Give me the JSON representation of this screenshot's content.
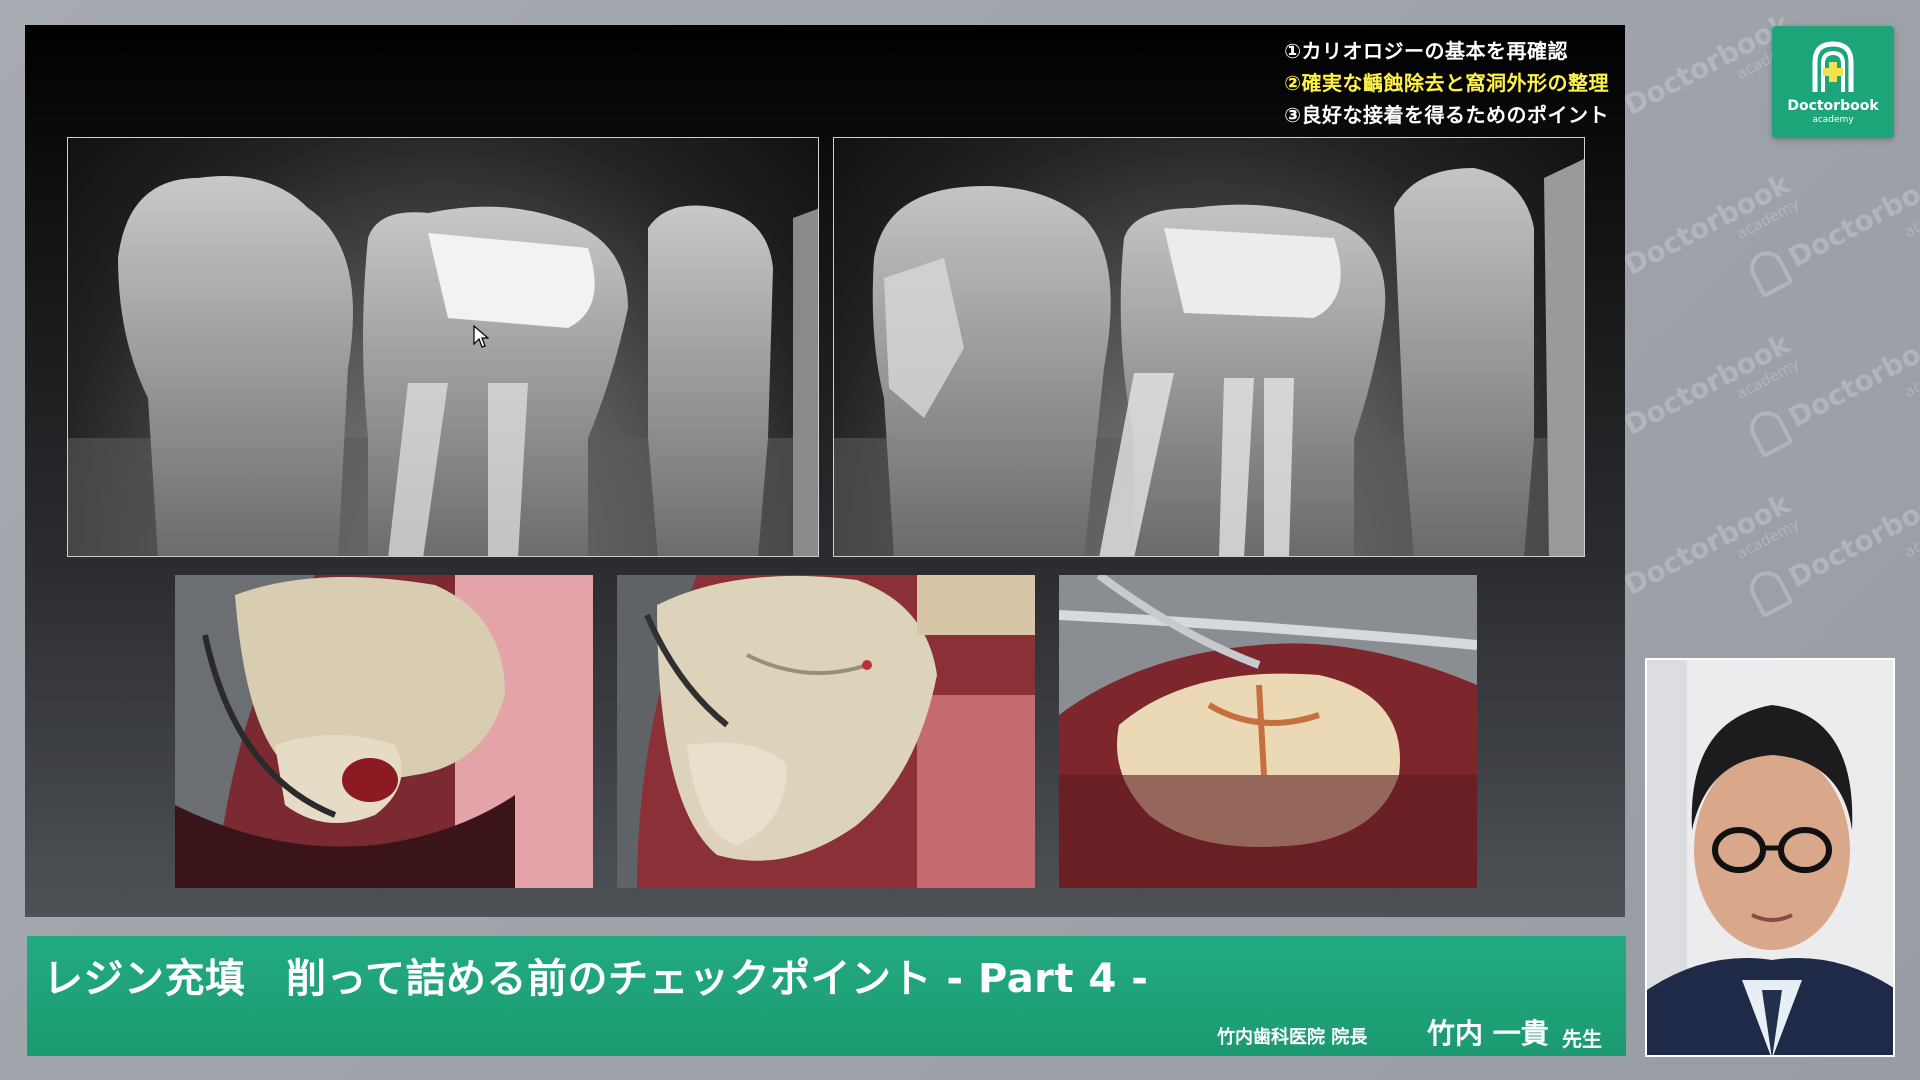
{
  "slide": {
    "points": [
      {
        "text": "①カリオロジーの基本を再確認",
        "highlight": false
      },
      {
        "text": "②確実な齲蝕除去と窩洞外形の整理",
        "highlight": true
      },
      {
        "text": "③良好な接着を得るためのポイント",
        "highlight": false
      }
    ]
  },
  "banner": {
    "title": "レジン充填　削って詰める前のチェックポイント - Part 4 -",
    "clinic": "竹内歯科医院 院長",
    "speaker": "竹内 一貴",
    "honorific": "先生"
  },
  "logo": {
    "name": "Doctorbook",
    "sub": "academy",
    "icon": "doctorbook-logo-icon"
  },
  "watermark": {
    "name": "Doctorbook",
    "sub": "academy"
  },
  "colors": {
    "brand_green": "#1fa37a",
    "highlight_yellow": "#fff34a",
    "background_gray": "#9fa3aa"
  }
}
